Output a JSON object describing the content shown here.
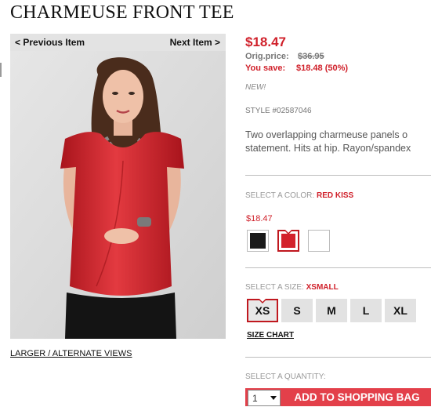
{
  "product": {
    "title": "CHARMEUSE FRONT TEE",
    "price": "$18.47",
    "orig_label": "Orig.price:",
    "orig_price": "$36.95",
    "save_label": "You save:",
    "save_value": "$18.48 (50%)",
    "badge": "NEW!",
    "style": "STYLE #02587046",
    "description_line1": "Two overlapping charmeuse panels o",
    "description_line2": "statement. Hits at hip. Rayon/spandex"
  },
  "image_nav": {
    "prev_label": "< Previous Item",
    "next_label": "Next Item >",
    "alt_views_label": "LARGER / ALTERNATE VIEWS"
  },
  "color": {
    "label": "SELECT A COLOR:",
    "selected": "RED KISS",
    "swatch_price": "$18.47",
    "swatches": [
      {
        "name": "black",
        "hex": "#1a1a1a"
      },
      {
        "name": "red-kiss",
        "hex": "#d3222c"
      },
      {
        "name": "white",
        "hex": "#ffffff"
      }
    ]
  },
  "size": {
    "label": "SELECT A SIZE:",
    "selected": "XSMALL",
    "options": [
      "XS",
      "S",
      "M",
      "L",
      "XL"
    ],
    "chart_label": "SIZE CHART"
  },
  "quantity": {
    "label": "SELECT A QUANTITY:",
    "value": "1"
  },
  "cart": {
    "add_label": "ADD TO SHOPPING BAG"
  },
  "colors": {
    "accent": "#d0202a",
    "button": "#e3404a"
  }
}
